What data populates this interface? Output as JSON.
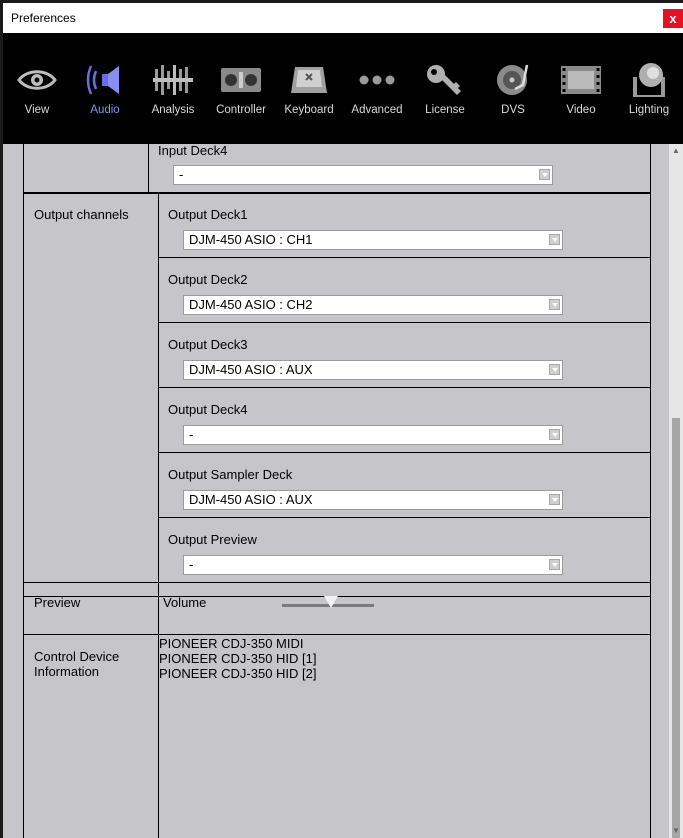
{
  "window": {
    "title": "Preferences",
    "close_glyph": "x"
  },
  "toolbar": {
    "active": "Audio",
    "tabs": [
      {
        "label": "View",
        "icon": "eye-icon"
      },
      {
        "label": "Audio",
        "icon": "speaker-icon"
      },
      {
        "label": "Analysis",
        "icon": "waveform-icon"
      },
      {
        "label": "Controller",
        "icon": "controller-icon"
      },
      {
        "label": "Keyboard",
        "icon": "keyboard-icon"
      },
      {
        "label": "Advanced",
        "icon": "dots-icon"
      },
      {
        "label": "License",
        "icon": "key-icon"
      },
      {
        "label": "DVS",
        "icon": "turntable-icon"
      },
      {
        "label": "Video",
        "icon": "film-icon"
      },
      {
        "label": "Lighting",
        "icon": "moving-head-light-icon"
      }
    ],
    "active_color": "#8a8ef0"
  },
  "input_partial": {
    "label": "Input Deck4",
    "value": "-"
  },
  "output_channels": {
    "label": "Output channels",
    "items": [
      {
        "label": "Output Deck1",
        "value": "DJM-450 ASIO : CH1"
      },
      {
        "label": "Output Deck2",
        "value": "DJM-450 ASIO : CH2"
      },
      {
        "label": "Output Deck3",
        "value": "DJM-450 ASIO : AUX"
      },
      {
        "label": "Output Deck4",
        "value": "-"
      },
      {
        "label": "Output Sampler Deck",
        "value": "DJM-450 ASIO : AUX"
      },
      {
        "label": "Output Preview",
        "value": "-"
      }
    ]
  },
  "preview": {
    "label": "Preview",
    "volume_label": "Volume",
    "volume_level": 0.53
  },
  "control_device": {
    "label": "Control Device Information",
    "devices": [
      "PIONEER CDJ-350 MIDI",
      "PIONEER CDJ-350 HID [1]",
      "PIONEER CDJ-350 HID [2]"
    ]
  }
}
